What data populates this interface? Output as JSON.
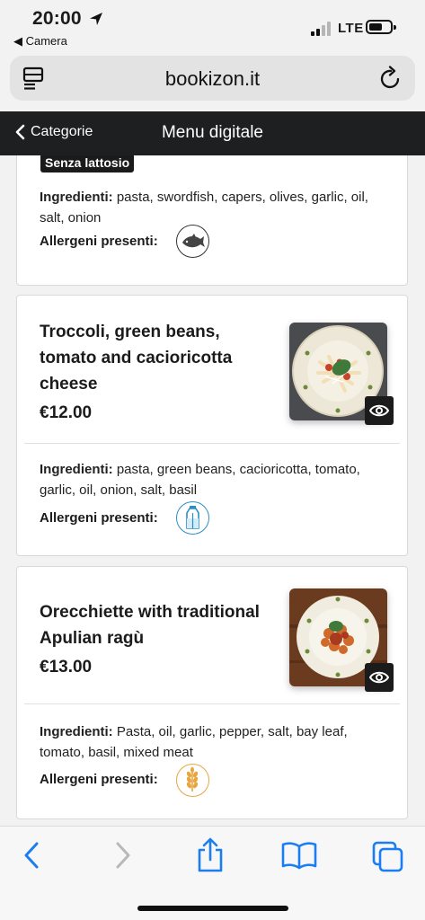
{
  "status_bar": {
    "time": "20:00",
    "back_app": "◀ Camera",
    "network": "LTE"
  },
  "browser": {
    "url": "bookizon.it"
  },
  "header": {
    "back_label": "Categorie",
    "title": "Menu digitale"
  },
  "items": [
    {
      "badge": "Senza lattosio",
      "ingredients_label": "Ingredienti:",
      "ingredients": "pasta, swordfish, capers, olives, garlic, oil, salt, onion",
      "allergens_label": "Allergeni presenti:",
      "allergen_icon": "fish-icon"
    },
    {
      "name": "Troccoli, green beans, tomato and cacioricotta cheese",
      "price": "€12.00",
      "ingredients_label": "Ingredienti:",
      "ingredients": "pasta, green beans, cacioricotta, tomato, garlic, oil, onion, salt, basil",
      "allergens_label": "Allergeni presenti:",
      "allergen_icon": "milk-icon"
    },
    {
      "name": "Orecchiette with traditional Apulian ragù",
      "price": "€13.00",
      "ingredients_label": "Ingredienti:",
      "ingredients": "Pasta, oil, garlic, pepper, salt, bay leaf, tomato, basil, mixed meat",
      "allergens_label": "Allergeni presenti:",
      "allergen_icon": "wheat-icon"
    }
  ],
  "colors": {
    "header_bg": "#1e1f21",
    "ios_blue": "#1a7ef2",
    "milk_blue": "#2a8fc9",
    "wheat_gold": "#e8a640"
  }
}
